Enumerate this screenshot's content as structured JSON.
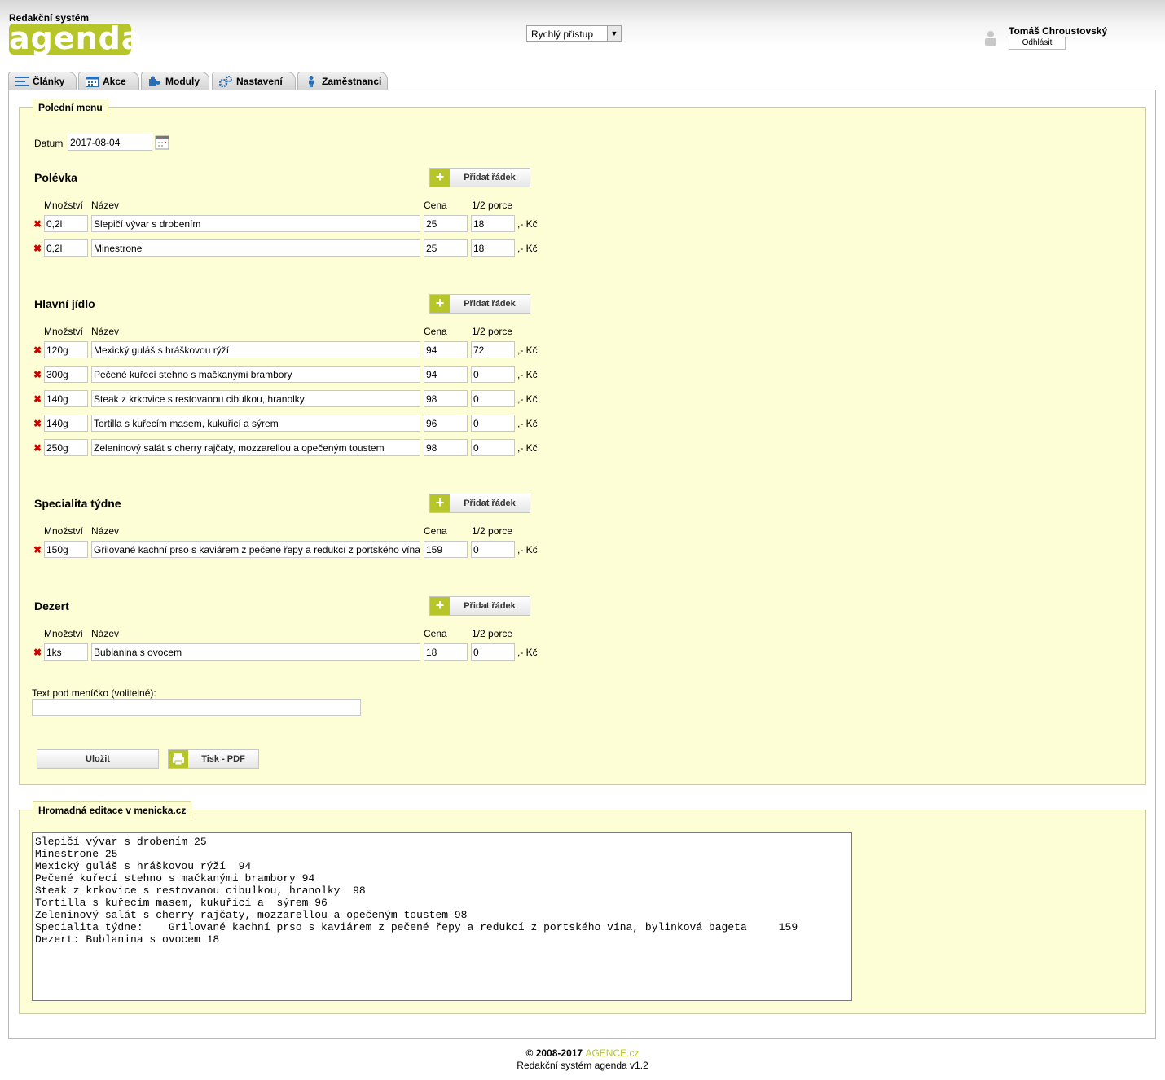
{
  "header": {
    "subtitle": "Redakční systém",
    "logo": "agenda",
    "quick_access": "Rychlý přístup",
    "user_name": "Tomáš Chroustovský",
    "logout": "Odhlásit"
  },
  "tabs": [
    {
      "label": "Články",
      "icon": "list-icon"
    },
    {
      "label": "Akce",
      "icon": "calendar-icon"
    },
    {
      "label": "Moduly",
      "icon": "puzzle-icon"
    },
    {
      "label": "Nastavení",
      "icon": "gears-icon"
    },
    {
      "label": "Zaměstnanci",
      "icon": "person-icon"
    }
  ],
  "menu_panel": {
    "legend": "Polední menu",
    "date_label": "Datum",
    "date_value": "2017-08-04",
    "col_qty": "Množství",
    "col_name": "Název",
    "col_price": "Cena",
    "col_half": "1/2 porce",
    "currency": ",- Kč",
    "add_row": "Přidat řádek",
    "sections": [
      {
        "title": "Polévka",
        "rows": [
          {
            "qty": "0,2l",
            "name": "Slepičí vývar s drobením",
            "price": "25",
            "half": "18"
          },
          {
            "qty": "0,2l",
            "name": "Minestrone",
            "price": "25",
            "half": "18"
          }
        ]
      },
      {
        "title": "Hlavní jídlo",
        "rows": [
          {
            "qty": "120g",
            "name": "Mexický guláš s hráškovou rýží",
            "price": "94",
            "half": "72"
          },
          {
            "qty": "300g",
            "name": "Pečené kuřecí stehno s mačkanými brambory",
            "price": "94",
            "half": "0"
          },
          {
            "qty": "140g",
            "name": "Steak z krkovice s restovanou cibulkou, hranolky",
            "price": "98",
            "half": "0"
          },
          {
            "qty": "140g",
            "name": "Tortilla s kuřecím masem, kukuřicí a  sýrem",
            "price": "96",
            "half": "0"
          },
          {
            "qty": "250g",
            "name": "Zeleninový salát s cherry rajčaty, mozzarellou a opečeným toustem",
            "price": "98",
            "half": "0"
          }
        ]
      },
      {
        "title": "Specialita týdne",
        "rows": [
          {
            "qty": "150g",
            "name": "   Grilované kachní prso s kaviárem z pečené řepy a redukcí z portského vína, bylinková bageta",
            "price": "159",
            "half": "0"
          }
        ]
      },
      {
        "title": "Dezert",
        "rows": [
          {
            "qty": "1ks",
            "name": "Bublanina s ovocem",
            "price": "18",
            "half": "0"
          }
        ]
      }
    ],
    "note_label": "Text pod meníčko (volitelné):",
    "note_value": "",
    "save": "Uložit",
    "print": "Tisk - PDF"
  },
  "bulk_panel": {
    "legend": "Hromadná editace v menicka.cz",
    "text": "Slepičí vývar s drobením 25\nMinestrone 25\nMexický guláš s hráškovou rýží  94\nPečené kuřecí stehno s mačkanými brambory 94\nSteak z krkovice s restovanou cibulkou, hranolky  98\nTortilla s kuřecím masem, kukuřicí a  sýrem 96\nZeleninový salát s cherry rajčaty, mozzarellou a opečeným toustem 98\nSpecialita týdne:    Grilované kachní prso s kaviárem z pečené řepy a redukcí z portského vína, bylinková bageta     159\nDezert: Bublanina s ovocem 18"
  },
  "footer": {
    "copyright": "© 2008-2017 ",
    "brand": "AGENCE.cz",
    "version": "Redakční systém agenda v1.2"
  },
  "colors": {
    "accent": "#b5c52a",
    "panel_bg": "#fdfdd6",
    "delete": "#d40000"
  }
}
